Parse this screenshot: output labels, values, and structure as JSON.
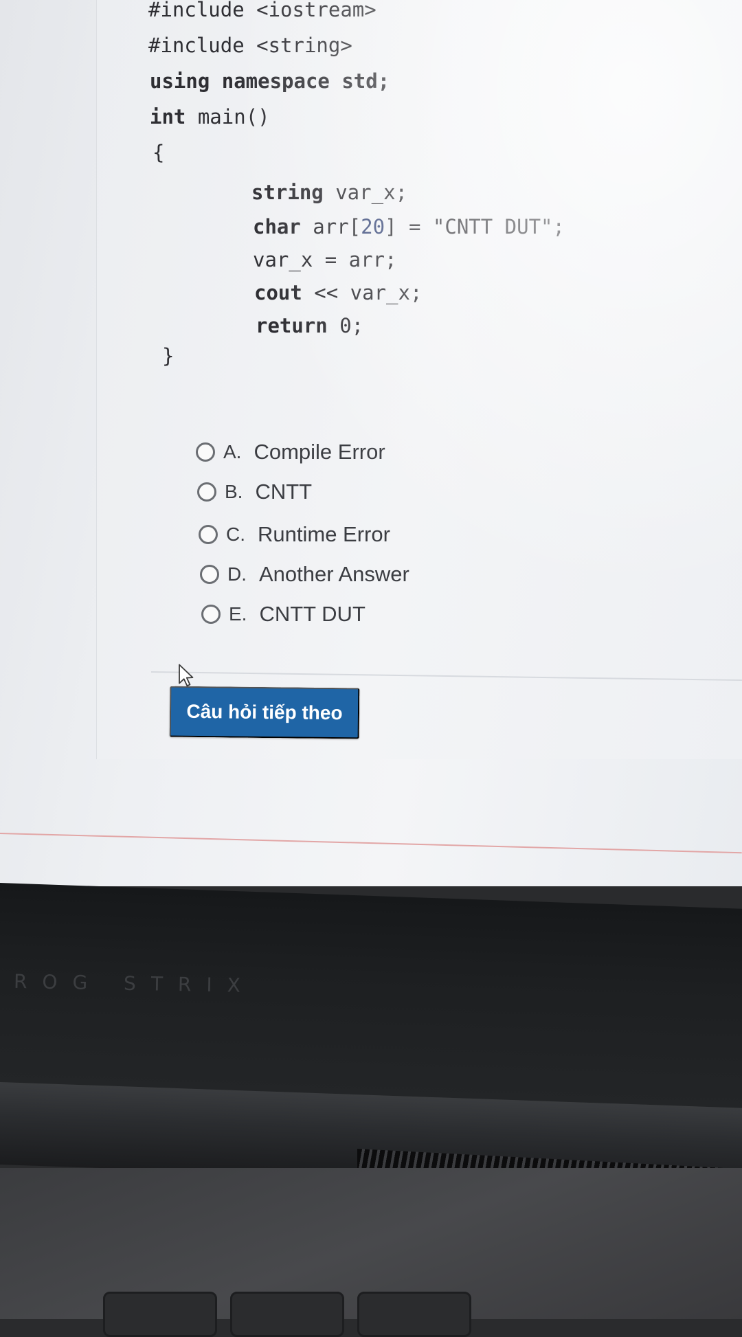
{
  "code": {
    "lines": [
      {
        "parts": [
          {
            "t": "#include <iostream>",
            "k": "plain"
          }
        ]
      },
      {
        "parts": [
          {
            "t": "#include <string>",
            "k": "plain"
          }
        ]
      },
      {
        "parts": [
          {
            "t": "using namespace std;",
            "k": "kw"
          }
        ]
      },
      {
        "parts": [
          {
            "t": "int",
            "k": "kw"
          },
          {
            "t": " main()",
            "k": "plain"
          }
        ]
      },
      {
        "parts": [
          {
            "t": "{",
            "k": "plain"
          }
        ]
      },
      {
        "parts": [
          {
            "t": "string",
            "k": "kw"
          },
          {
            "t": " var_x;",
            "k": "plain"
          }
        ]
      },
      {
        "parts": [
          {
            "t": "char",
            "k": "kw"
          },
          {
            "t": " arr[",
            "k": "plain"
          },
          {
            "t": "20",
            "k": "num"
          },
          {
            "t": "] = \"CNTT DUT\";",
            "k": "plain"
          }
        ]
      },
      {
        "parts": [
          {
            "t": "var_x = arr;",
            "k": "plain"
          }
        ]
      },
      {
        "parts": [
          {
            "t": "cout",
            "k": "kw"
          },
          {
            "t": " << var_x;",
            "k": "plain"
          }
        ]
      },
      {
        "parts": [
          {
            "t": "return",
            "k": "kw"
          },
          {
            "t": " 0;",
            "k": "plain"
          }
        ]
      },
      {
        "parts": [
          {
            "t": "}",
            "k": "plain"
          }
        ]
      }
    ]
  },
  "options": [
    {
      "letter": "A.",
      "text": "Compile Error"
    },
    {
      "letter": "B.",
      "text": "CNTT"
    },
    {
      "letter": "C.",
      "text": "Runtime Error"
    },
    {
      "letter": "D.",
      "text": "Another Answer"
    },
    {
      "letter": "E.",
      "text": "CNTT DUT"
    }
  ],
  "next_button_label": "Câu hỏi tiếp theo",
  "laptop_brand": "ROG STRIX"
}
